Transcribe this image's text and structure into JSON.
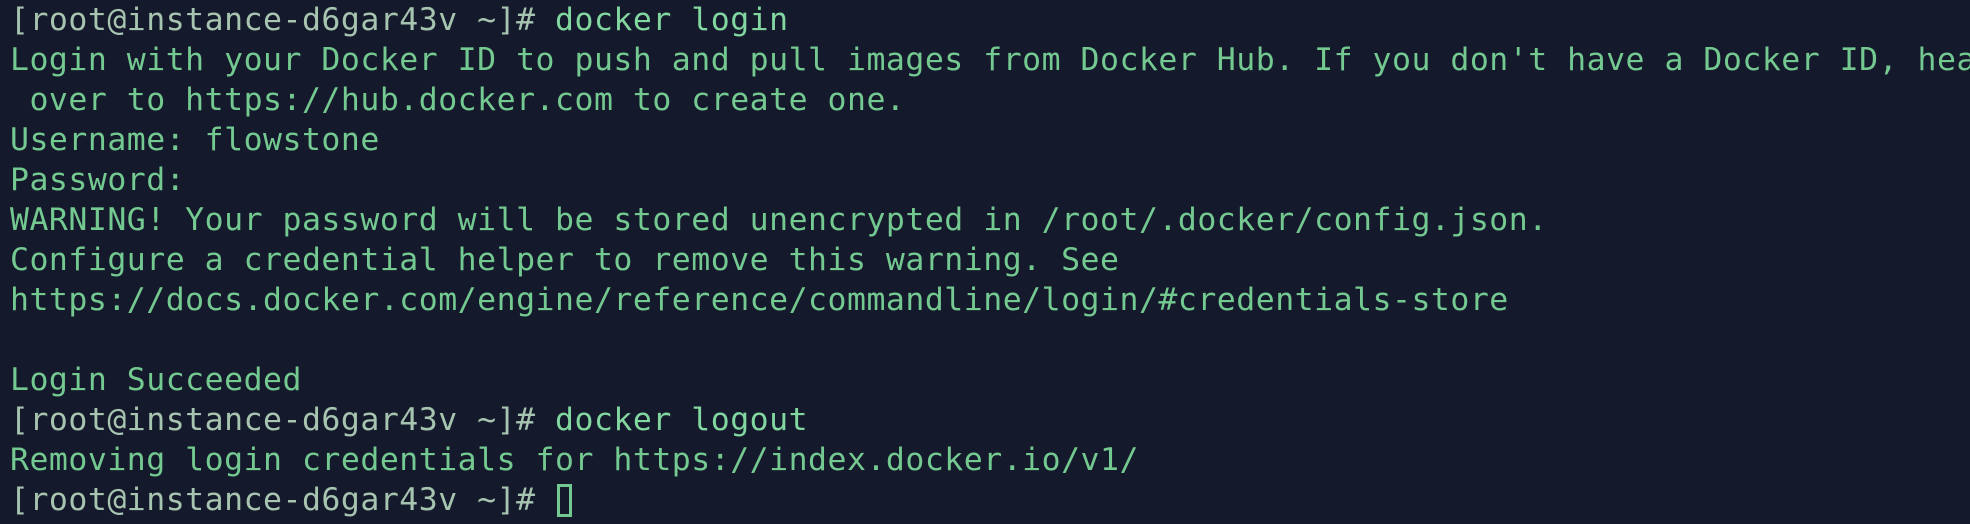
{
  "terminal": {
    "colors": {
      "background": "#141a2b",
      "text": "#74c991",
      "prompt": "#a7c4b0",
      "cursor": "#74c991"
    },
    "prompt": "[root@instance-d6gar43v ~]# ",
    "lines": {
      "cmd1": "docker login",
      "msg1": "Login with your Docker ID to push and pull images from Docker Hub. If you don't have a Docker ID, head",
      "msg2": " over to https://hub.docker.com to create one.",
      "username": "Username: flowstone",
      "password": "Password:",
      "warning": "WARNING! Your password will be stored unencrypted in /root/.docker/config.json.",
      "configure": "Configure a credential helper to remove this warning. See",
      "link": "https://docs.docker.com/engine/reference/commandline/login/#credentials-store",
      "succeeded": "Login Succeeded",
      "cmd2": "docker logout",
      "removing": "Removing login credentials for https://index.docker.io/v1/"
    }
  }
}
